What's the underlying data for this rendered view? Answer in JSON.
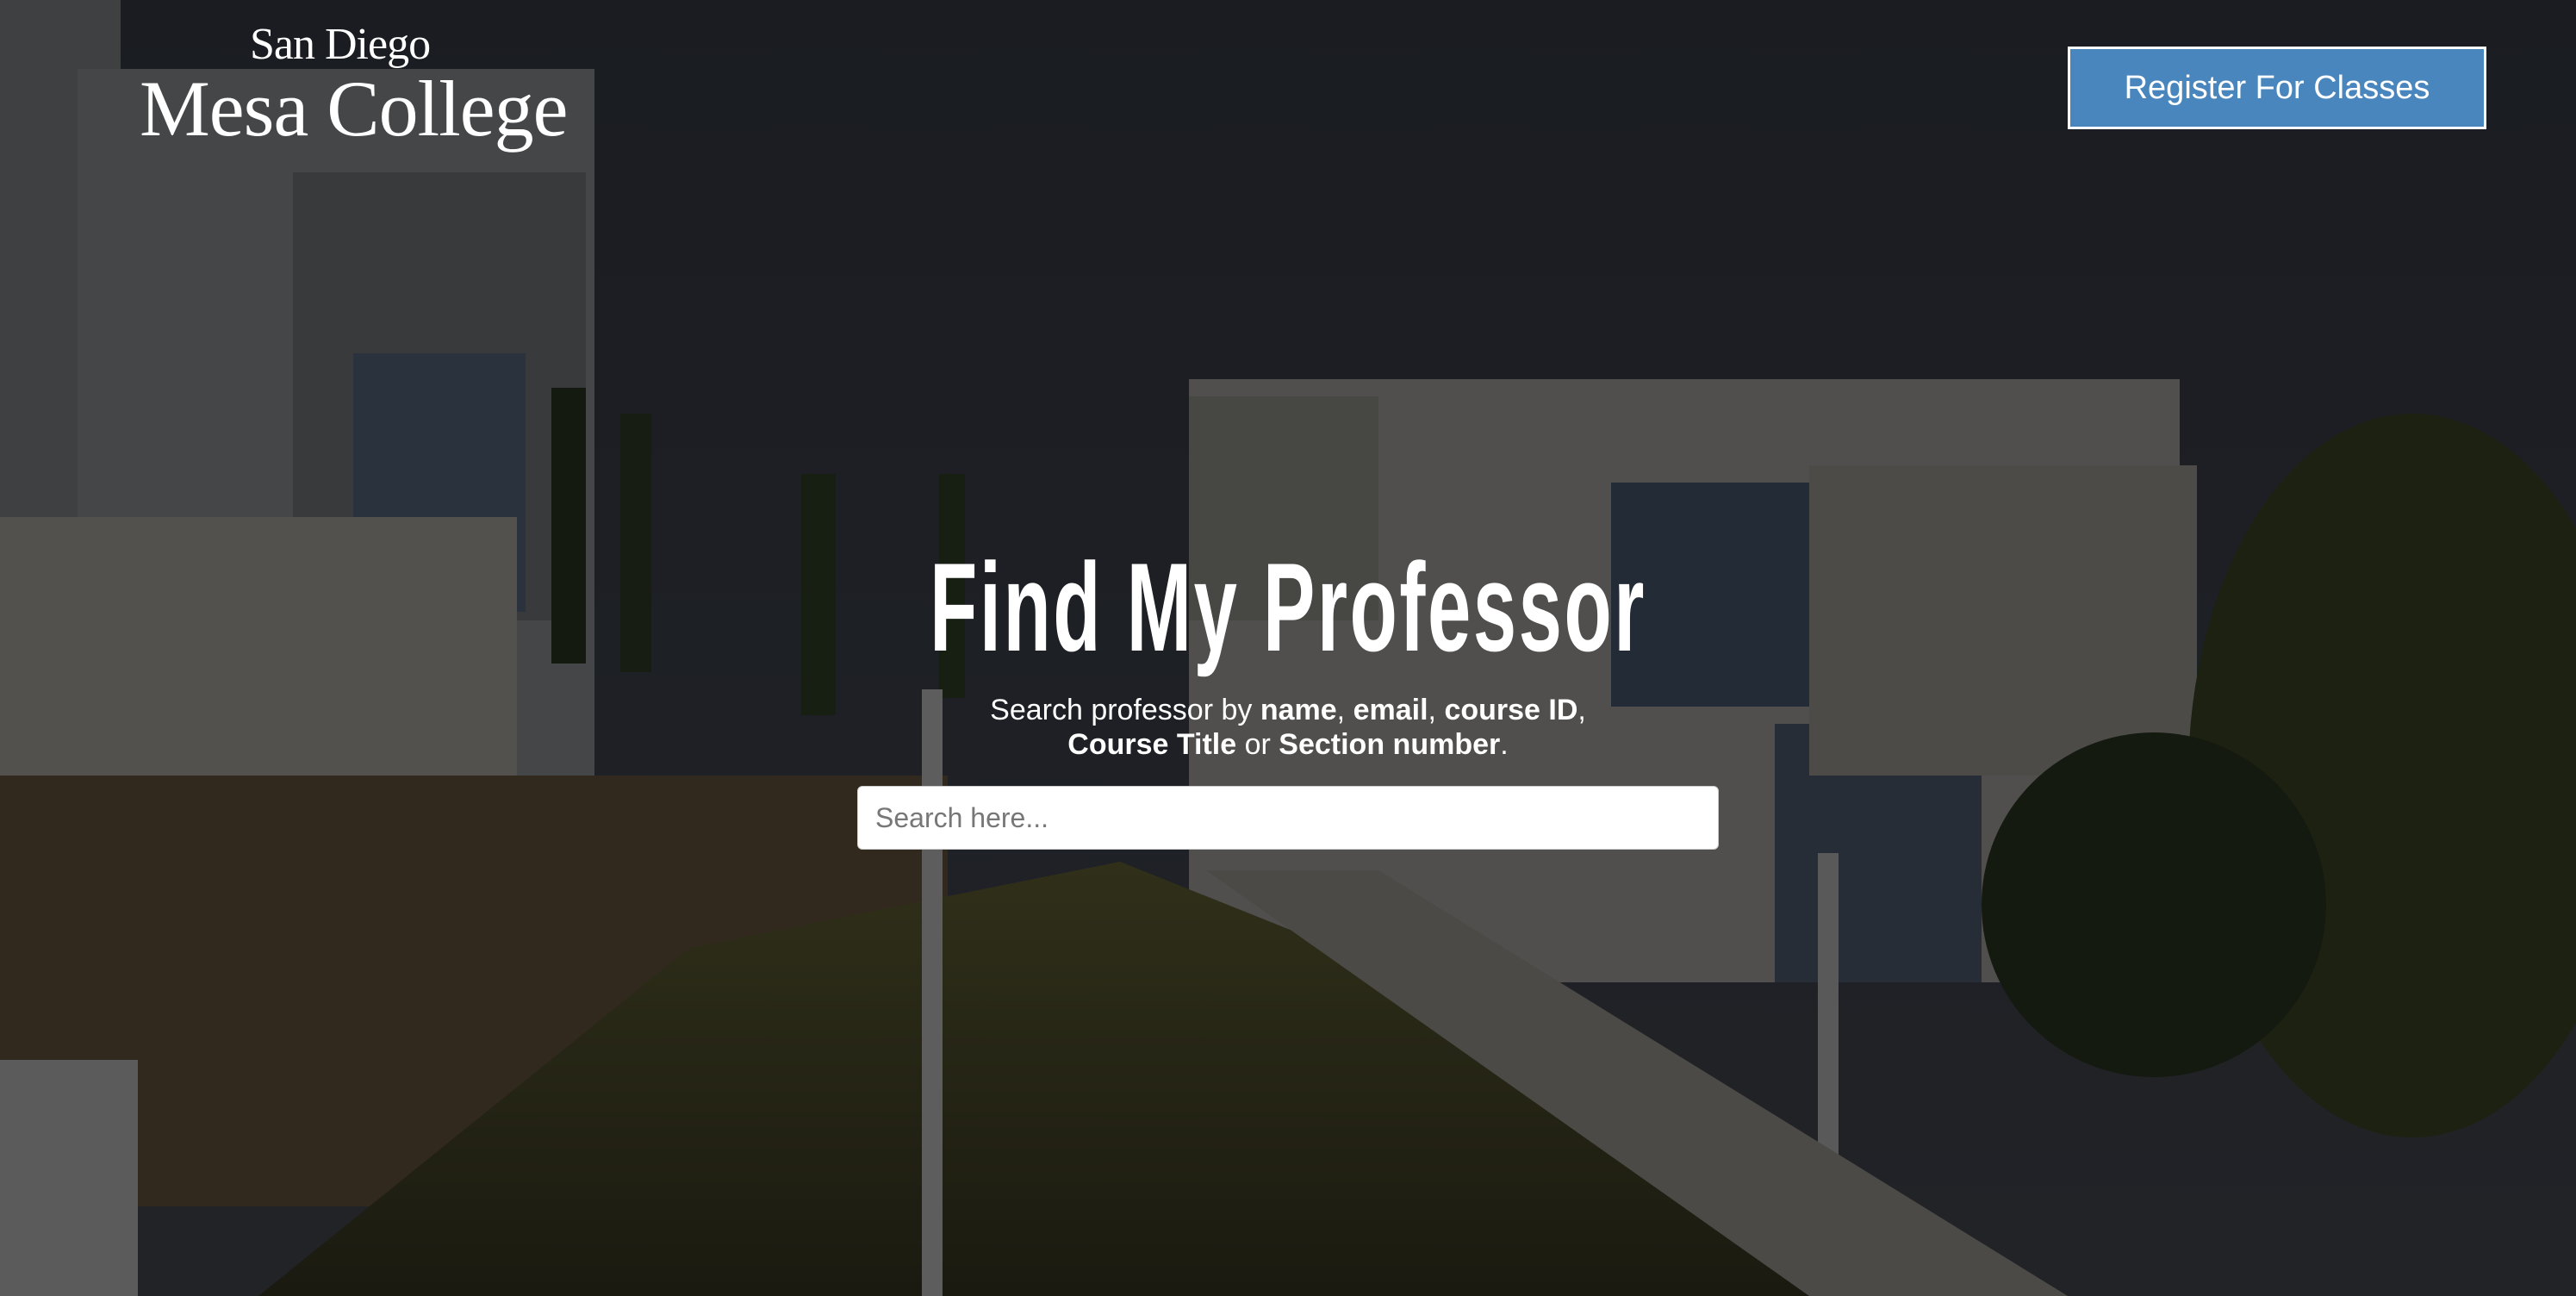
{
  "header": {
    "logo": {
      "line1": "San Diego",
      "line2": "Mesa College"
    },
    "register_button": "Register For Classes"
  },
  "hero": {
    "title": "Find My Professor",
    "subtitle": {
      "prefix": "Search professor by ",
      "term1": "name",
      "sep1": ", ",
      "term2": "email",
      "sep2": ", ",
      "term3": "course ID",
      "sep3": ",",
      "term4": "Course Title",
      "or": " or ",
      "term5": "Section number",
      "end": "."
    },
    "search": {
      "placeholder": "Search here...",
      "value": ""
    }
  },
  "colors": {
    "button_bg": "#4a86be",
    "overlay": "rgba(0,0,0,0.55)"
  }
}
